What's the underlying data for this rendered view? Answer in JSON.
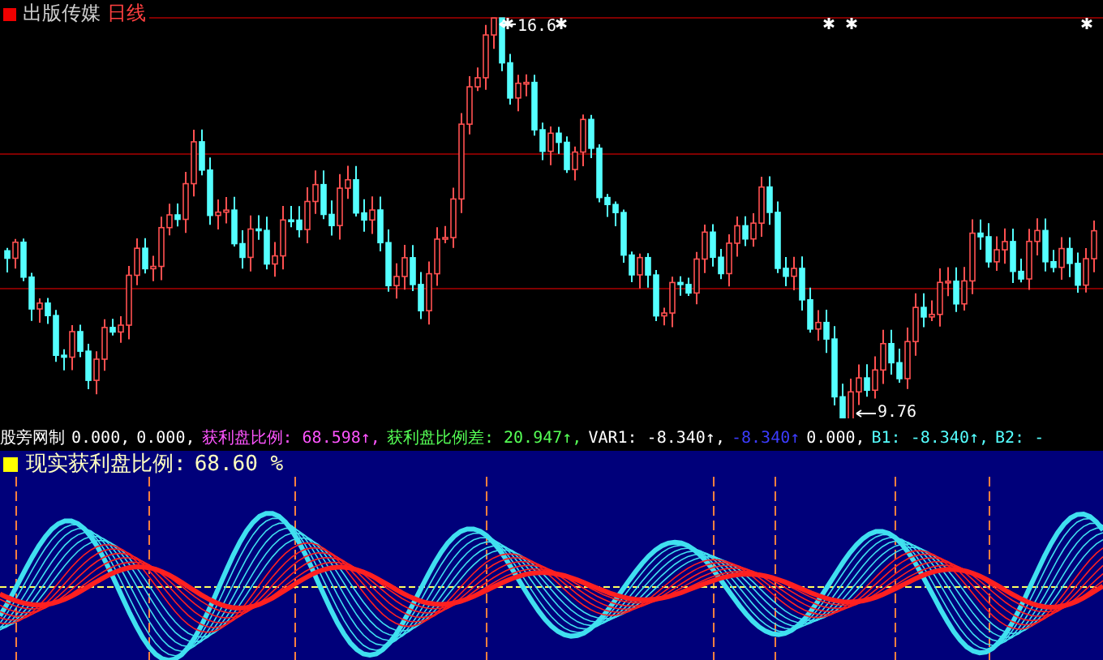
{
  "title": {
    "name": "出版传媒",
    "period": "日线"
  },
  "price_chart": {
    "high_label": "16.6",
    "low_label": "9.76"
  },
  "indicator_line": {
    "items": [
      {
        "text": "股旁网制",
        "color": "#ffffff"
      },
      {
        "text": "0.000,",
        "color": "#ffffff"
      },
      {
        "text": "0.000,",
        "color": "#ffffff"
      },
      {
        "text": "获利盘比例: 68.598↑,",
        "color": "#ff55ff"
      },
      {
        "text": "获利盘比例差: 20.947↑,",
        "color": "#55ff55"
      },
      {
        "text": "VAR1: -8.340↑,",
        "color": "#ffffff"
      },
      {
        "text": "-8.340↑",
        "color": "#3c3cff"
      },
      {
        "text": "0.000,",
        "color": "#ffffff"
      },
      {
        "text": "B1: -8.340↑,",
        "color": "#55ffff"
      },
      {
        "text": "B2: -",
        "color": "#55ffff"
      }
    ]
  },
  "oscillator": {
    "label": "现实获利盘比例:",
    "value": "68.60 %"
  }
}
